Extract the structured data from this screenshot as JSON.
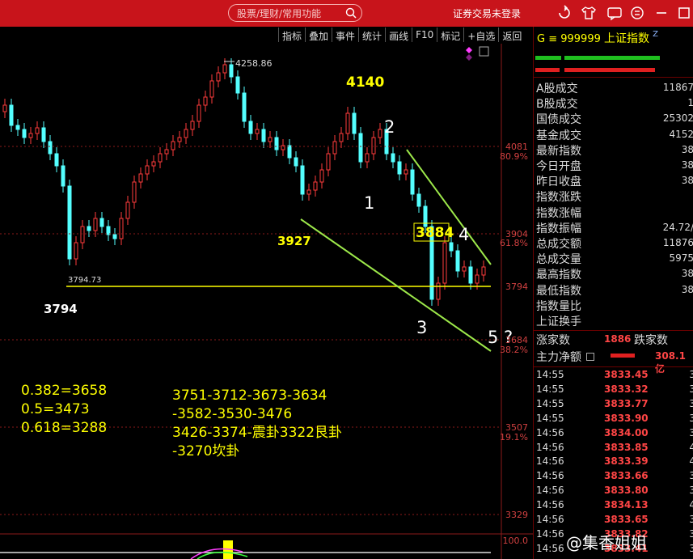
{
  "topbar": {
    "search_placeholder": "股票/理财/常用功能",
    "login_label": "证券交易未登录"
  },
  "toolbar": {
    "items": [
      "指标",
      "叠加",
      "事件",
      "统计",
      "画线",
      "F10",
      "标记",
      "+自选",
      "返回"
    ]
  },
  "chart": {
    "annotations": {
      "peak_label": "4258.86",
      "low_label": "3794.73",
      "wave_4140": "4140",
      "wave_3927": "3927",
      "wave_3794": "3794",
      "wave_3884": "3884",
      "w1": "1",
      "w2": "2",
      "w3": "3",
      "w4": "4",
      "w5": "5 ?"
    },
    "fib_lines": [
      "0.382=3658",
      "0.5=3473",
      "0.618=3288"
    ],
    "targets": [
      "3751-3712-3673-3634",
      "-3582-3530-3476",
      "3426-3374-震卦3322艮卦",
      "-3270坎卦"
    ],
    "axis_labels": [
      {
        "value": "4081",
        "pct": "80.9%"
      },
      {
        "value": "3904",
        "pct": "61.8%"
      },
      {
        "value": "3794",
        "pct": ""
      },
      {
        "value": "3684",
        "pct": "38.2%"
      },
      {
        "value": "3507",
        "pct": "19.1%"
      },
      {
        "value": "3329",
        "pct": ""
      },
      {
        "value": "100.0",
        "pct": ""
      }
    ],
    "colors": {
      "up": "#ff3c3c",
      "down": "#54ffff",
      "trend": "#9de84a",
      "support": "#ffff00"
    }
  },
  "panel": {
    "index_code": "G ≡ 999999",
    "index_name": "上证指数",
    "rows": [
      {
        "label": "A股成交",
        "value": "11867"
      },
      {
        "label": "B股成交",
        "value": "1"
      },
      {
        "label": "国债成交",
        "value": "25302"
      },
      {
        "label": "基金成交",
        "value": "4152"
      },
      {
        "label": "最新指数",
        "value": "38"
      },
      {
        "label": "今日开盘",
        "value": "38"
      },
      {
        "label": "昨日收盘",
        "value": "38"
      },
      {
        "label": "指数涨跌",
        "value": ""
      },
      {
        "label": "指数涨幅",
        "value": ""
      },
      {
        "label": "指数振幅",
        "value": "24.72/"
      },
      {
        "label": "总成交额",
        "value": "11876"
      },
      {
        "label": "总成交量",
        "value": "5975"
      },
      {
        "label": "最高指数",
        "value": "38"
      },
      {
        "label": "最低指数",
        "value": "38"
      },
      {
        "label": "指数量比",
        "value": ""
      },
      {
        "label": "上证换手",
        "value": ""
      }
    ],
    "rise_label": "涨家数",
    "rise_count": "1886",
    "fall_label": "跌家数",
    "mainforce_label": "主力净额",
    "mainforce_value": "308.1亿",
    "ticks": [
      {
        "t": "14:55",
        "p": "3833.45",
        "v": "3"
      },
      {
        "t": "14:55",
        "p": "3833.32",
        "v": "3"
      },
      {
        "t": "14:55",
        "p": "3833.77",
        "v": "3"
      },
      {
        "t": "14:55",
        "p": "3833.90",
        "v": "3"
      },
      {
        "t": "14:56",
        "p": "3834.00",
        "v": "3"
      },
      {
        "t": "14:56",
        "p": "3833.85",
        "v": "4"
      },
      {
        "t": "14:56",
        "p": "3833.39",
        "v": "4"
      },
      {
        "t": "14:56",
        "p": "3833.66",
        "v": "3"
      },
      {
        "t": "14:56",
        "p": "3833.80",
        "v": "3"
      },
      {
        "t": "14:56",
        "p": "3834.13",
        "v": "4"
      },
      {
        "t": "14:56",
        "p": "3833.65",
        "v": "3"
      },
      {
        "t": "14:56",
        "p": "3833.82",
        "v": "3"
      },
      {
        "t": "14:56",
        "p": "3833.41",
        "v": "3"
      }
    ]
  },
  "watermark": "@集香姐姐"
}
